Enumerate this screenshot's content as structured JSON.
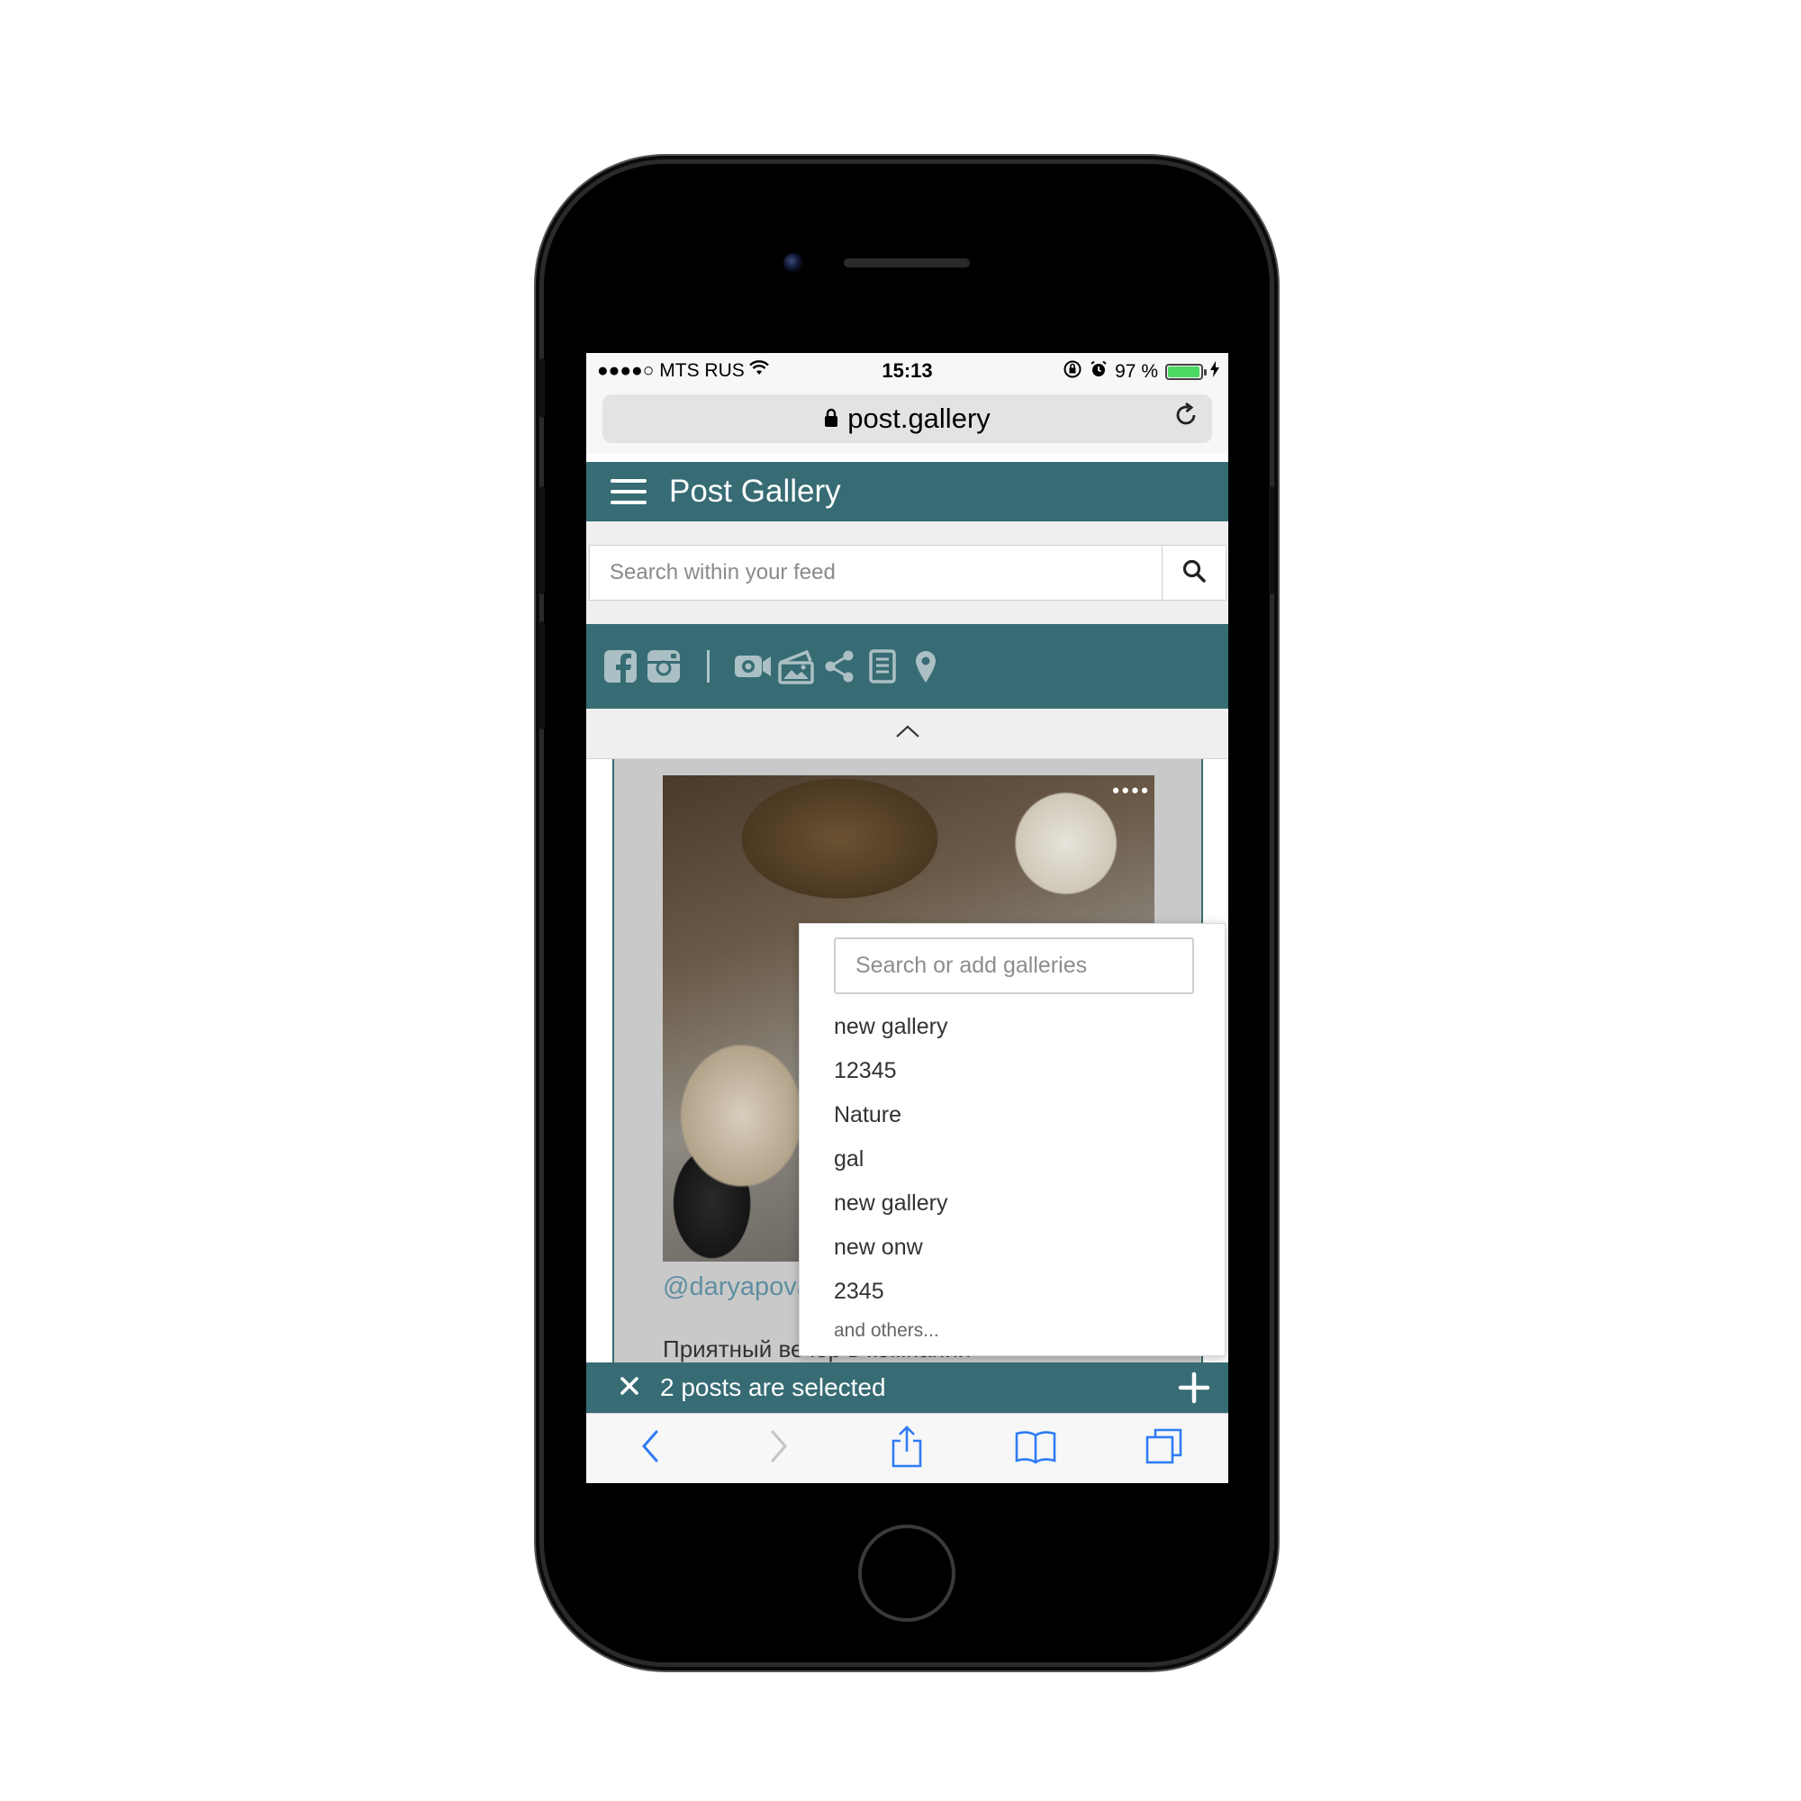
{
  "status_bar": {
    "carrier": "●●●●○ MTS RUS",
    "time": "15:13",
    "battery_percent": "97 %",
    "battery_level": 0.97
  },
  "browser": {
    "url": "post.gallery"
  },
  "app": {
    "title": "Post Gallery"
  },
  "search": {
    "placeholder": "Search within your feed"
  },
  "filters": {
    "icons": [
      "facebook-icon",
      "instagram-icon",
      "video-icon",
      "photo-album-icon",
      "share-icon",
      "article-icon",
      "location-pin-icon"
    ]
  },
  "post": {
    "author": "@daryapova",
    "caption": "Приятный вечер в компании"
  },
  "gallery_dropdown": {
    "placeholder": "Search or add galleries",
    "items": [
      "new gallery",
      "12345",
      "Nature",
      "gal",
      "new gallery",
      "new onw",
      "2345"
    ],
    "more_text": "and others..."
  },
  "selection": {
    "text": "2 posts are selected"
  },
  "colors": {
    "brand": "#376c74",
    "toolbar_blue": "#2f7cf6"
  }
}
